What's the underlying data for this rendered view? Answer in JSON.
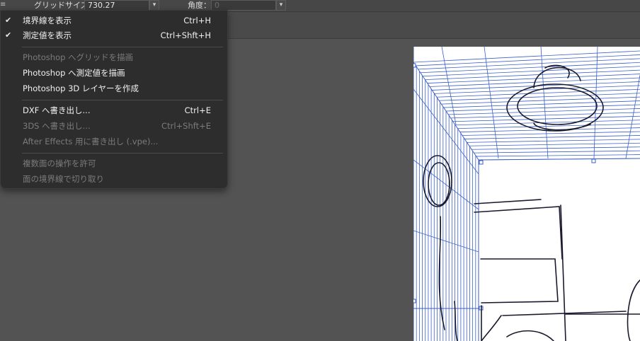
{
  "toolbar": {
    "grid_size_label": "グリッドサイズ：",
    "grid_size_value": "730.27",
    "angle_label": "角度：",
    "angle_value": "0",
    "menu_icon": "hamburger-icon",
    "dropdown_icon": "chevron-down-icon"
  },
  "menu": {
    "items": [
      {
        "label": "境界線を表示",
        "shortcut": "Ctrl+H",
        "checked": true,
        "enabled": true
      },
      {
        "label": "測定値を表示",
        "shortcut": "Ctrl+Shft+H",
        "checked": true,
        "enabled": true
      },
      {
        "label": "Photoshop へグリッドを描画",
        "shortcut": "",
        "checked": false,
        "enabled": false
      },
      {
        "label": "Photoshop へ測定値を描画",
        "shortcut": "",
        "checked": false,
        "enabled": true
      },
      {
        "label": "Photoshop 3D レイヤーを作成",
        "shortcut": "",
        "checked": false,
        "enabled": true
      },
      {
        "label": "DXF へ書き出し...",
        "shortcut": "Ctrl+E",
        "checked": false,
        "enabled": true
      },
      {
        "label": "3DS へ書き出し...",
        "shortcut": "Ctrl+Shft+E",
        "checked": false,
        "enabled": false
      },
      {
        "label": "After Effects 用に書き出し (.vpe)...",
        "shortcut": "",
        "checked": false,
        "enabled": false
      },
      {
        "label": "複数面の操作を許可",
        "shortcut": "",
        "checked": false,
        "enabled": false
      },
      {
        "label": "面の境界線で切り取り",
        "shortcut": "",
        "checked": false,
        "enabled": false
      }
    ],
    "check_glyph": "✔"
  },
  "colors": {
    "background": "#535353",
    "menu_bg": "#2d2d2d",
    "grid_line": "#3a5fc8",
    "sketch": "#1a1a2e"
  }
}
